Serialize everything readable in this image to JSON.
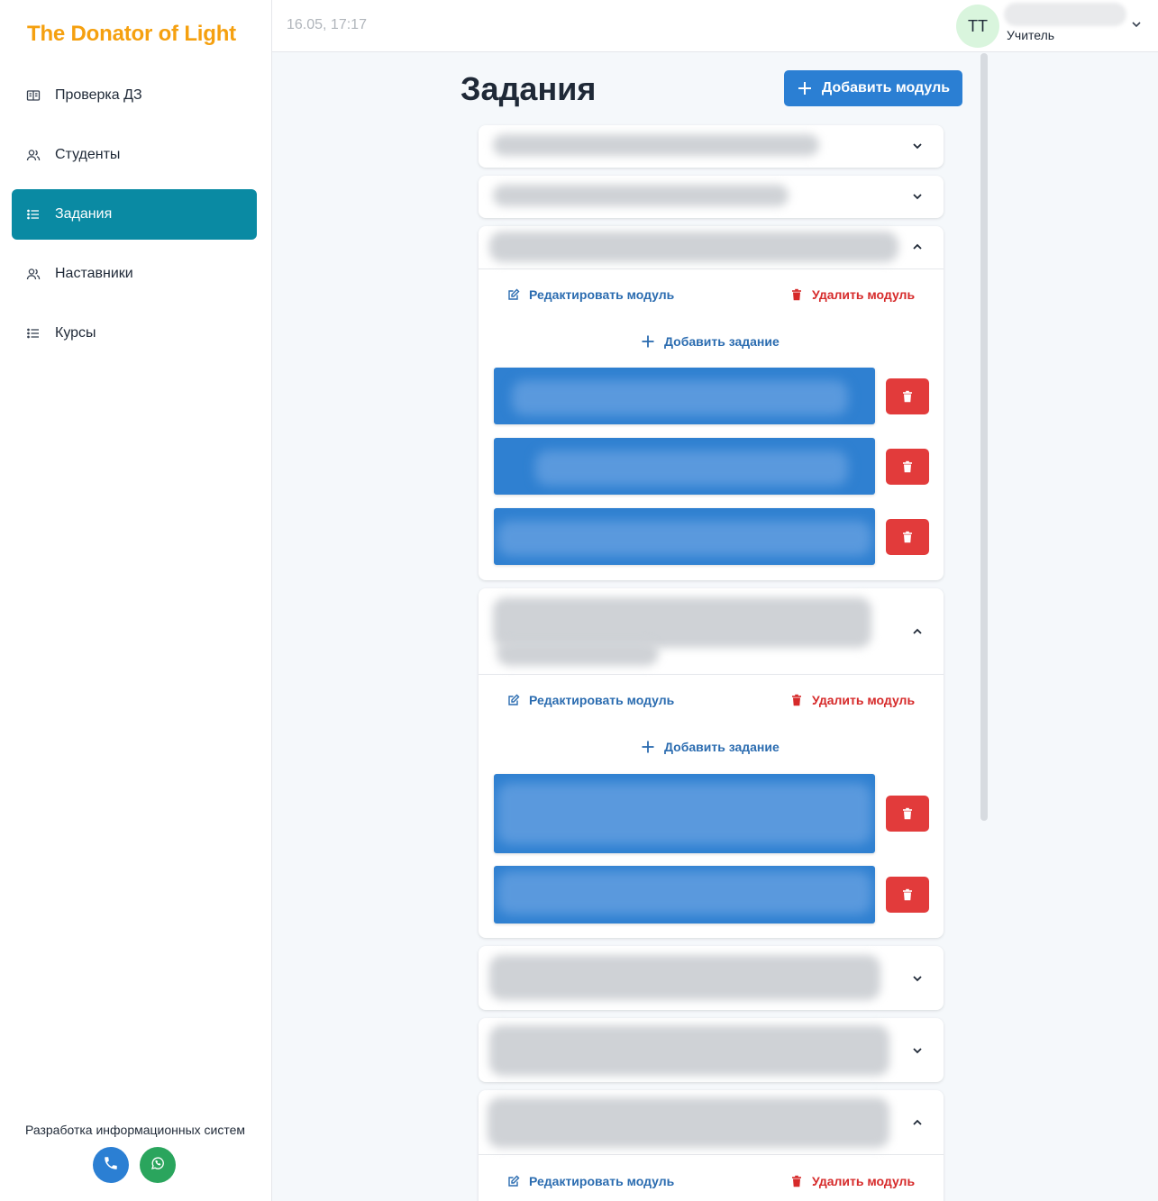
{
  "app": {
    "brand": "The Donator of Light",
    "brand_color": "#f5a00f",
    "accent_color": "#0a8aa3",
    "primary_color": "#2b7fd3",
    "danger_color": "#e23b3b"
  },
  "sidebar": {
    "items": [
      {
        "label": "Проверка ДЗ",
        "icon": "book-icon",
        "active": false
      },
      {
        "label": "Студенты",
        "icon": "users-icon",
        "active": false
      },
      {
        "label": "Задания",
        "icon": "list-icon",
        "active": true
      },
      {
        "label": "Наставники",
        "icon": "users-icon",
        "active": false
      },
      {
        "label": "Курсы",
        "icon": "list-icon",
        "active": false
      }
    ],
    "footer_text": "Разработка информационных систем",
    "contacts": [
      {
        "icon": "phone-icon"
      },
      {
        "icon": "whatsapp-icon"
      }
    ]
  },
  "header": {
    "datetime": "16.05, 17:17",
    "avatar_initials": "TT",
    "user_role": "Учитель"
  },
  "main": {
    "title": "Задания",
    "add_module_label": "Добавить модуль",
    "edit_module_label": "Редактировать модуль",
    "delete_module_label": "Удалить модуль",
    "add_task_label": "Добавить задание"
  }
}
